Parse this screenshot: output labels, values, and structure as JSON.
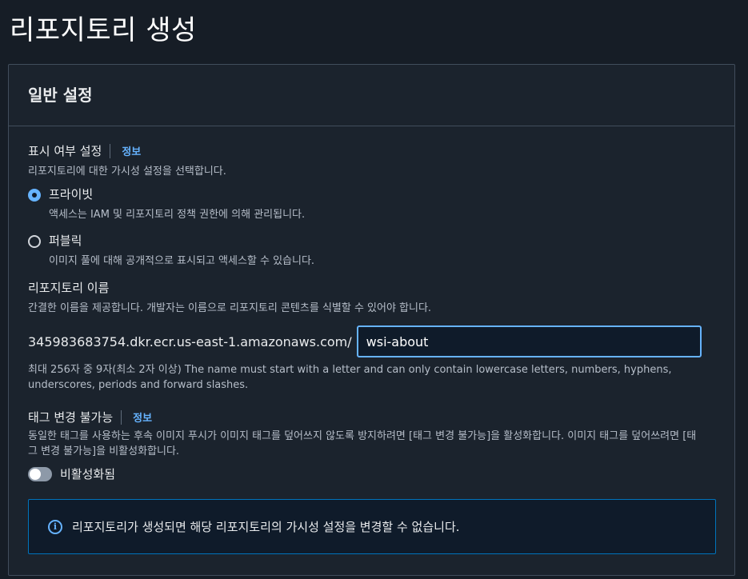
{
  "page": {
    "title": "리포지토리 생성"
  },
  "panel": {
    "title": "일반 설정"
  },
  "visibility": {
    "label": "표시 여부 설정",
    "info": "정보",
    "description": "리포지토리에 대한 가시성 설정을 선택합니다.",
    "options": [
      {
        "title": "프라이빗",
        "description": "액세스는 IAM 및 리포지토리 정책 권한에 의해 관리됩니다.",
        "selected": true
      },
      {
        "title": "퍼블릭",
        "description": "이미지 풀에 대해 공개적으로 표시되고 액세스할 수 있습니다.",
        "selected": false
      }
    ]
  },
  "repo_name": {
    "label": "리포지토리 이름",
    "description": "간결한 이름을 제공합니다. 개발자는 이름으로 리포지토리 콘텐츠를 식별할 수 있어야 합니다.",
    "uri_prefix": "345983683754.dkr.ecr.us-east-1.amazonaws.com/",
    "value": "wsi-about",
    "hint": "최대 256자 중 9자(최소 2자 이상) The name must start with a letter and can only contain lowercase letters, numbers, hyphens, underscores, periods and forward slashes."
  },
  "tag_immutability": {
    "label": "태그 변경 불가능",
    "info": "정보",
    "description": "동일한 태그를 사용하는 후속 이미지 푸시가 이미지 태그를 덮어쓰지 않도록 방지하려면 [태그 변경 불가능]을 활성화합니다. 이미지 태그를 덮어쓰려면 [태그 변경 불가능]을 비활성화합니다.",
    "toggle_label": "비활성화됨",
    "enabled": false
  },
  "alert": {
    "icon": "info-icon",
    "text": "리포지토리가 생성되면 해당 리포지토리의 가시성 설정을 변경할 수 없습니다."
  },
  "colors": {
    "background": "#161d26",
    "panel": "#1b232d",
    "accent": "#66b3ff",
    "alert_border": "#0073bb"
  }
}
